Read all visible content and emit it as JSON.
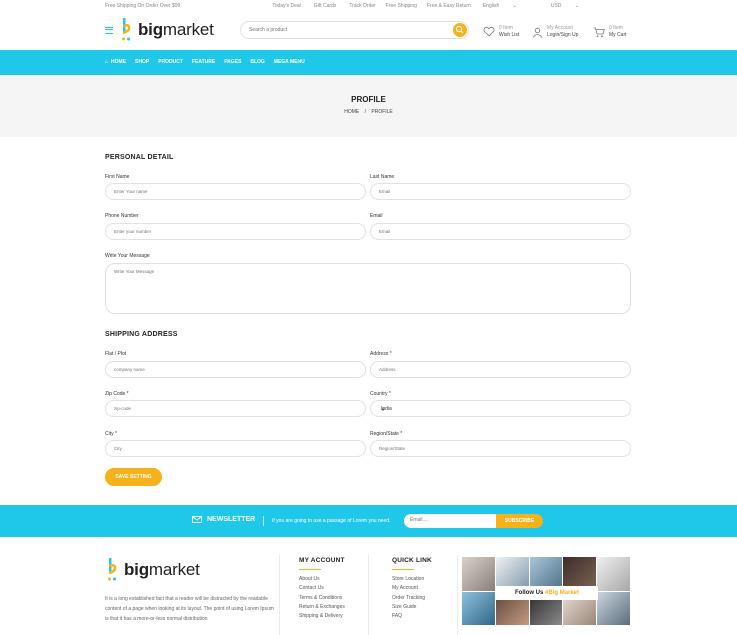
{
  "topbar": {
    "shipping": "Free Shipping On Order Over $99",
    "links": [
      "Today's Deal",
      "Gift Cards",
      "Track Order",
      "Free Shipping",
      "Free & Easy Return",
      "English",
      "USD"
    ]
  },
  "header": {
    "logo_bold": "big",
    "logo_rest": "market",
    "search_placeholder": "Search a product",
    "wishlist": {
      "count": "0 Item",
      "label": "Wish List"
    },
    "account": {
      "title": "My Account",
      "label": "Login/Sign Up"
    },
    "cart": {
      "count": "0 Item",
      "label": "My Cart"
    }
  },
  "nav": {
    "items": [
      "HOME",
      "SHOP",
      "PRODUCT",
      "FEATURE",
      "PAGES",
      "BLOG",
      "MEGA MENU"
    ]
  },
  "banner": {
    "title": "PROFILE",
    "crumb_home": "HOME",
    "crumb_sep": "/",
    "crumb_current": "PROFILE"
  },
  "personal": {
    "title": "PERSONAL DETAIL",
    "first_name": {
      "label": "First Name",
      "placeholder": "Enter Your name"
    },
    "last_name": {
      "label": "Last Name",
      "placeholder": "Email"
    },
    "phone": {
      "label": "Phone Number",
      "placeholder": "Enter your number"
    },
    "email": {
      "label": "Email",
      "placeholder": "Email"
    },
    "message": {
      "label": "Write Your Message",
      "placeholder": "Write Your Message"
    }
  },
  "shipping": {
    "title": "SHIPPING ADDRESS",
    "flat": {
      "label": "Flat / Plot",
      "placeholder": "company name"
    },
    "address": {
      "label": "Address *",
      "placeholder": "Address"
    },
    "zip": {
      "label": "Zip Code *",
      "placeholder": "zip-code"
    },
    "country": {
      "label": "Country *",
      "value": "India"
    },
    "city": {
      "label": "City *",
      "placeholder": "City"
    },
    "region": {
      "label": "Region/State *",
      "placeholder": "Region/State"
    }
  },
  "save_label": "SAVE SETTING",
  "newsletter": {
    "title": "NEWSLETTER",
    "text": "If you are going to use a passage of Lorem you need.",
    "placeholder": "Email....",
    "button": "SUBSCRIBE"
  },
  "footer": {
    "about": "It is a long established fact that a reader will be distracted by the readable content of a page when looking at its layout. The point of using Lorem Ipsum is that it has a more-or-less normal distribution",
    "my_account": {
      "title": "MY ACCOUNT",
      "items": [
        "About Us",
        "Contact Us",
        "Terms & Conditions",
        "Return & Exchanges",
        "Shipping & Delivery"
      ]
    },
    "quick_link": {
      "title": "QUICK LINK",
      "items": [
        "Store Location",
        "My Account",
        "Order Tracking",
        "Size Guide",
        "FAQ"
      ]
    },
    "follow_prefix": "Follow Us",
    "follow_brand": "#Big Market"
  },
  "colors": {
    "accent": "#1fc7e8",
    "button": "#f5b21b"
  }
}
